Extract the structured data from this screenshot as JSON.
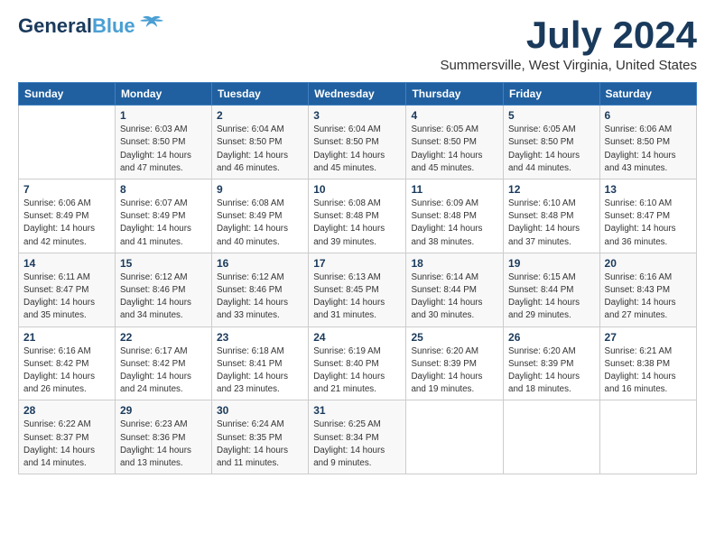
{
  "header": {
    "logo_general": "General",
    "logo_blue": "Blue",
    "month": "July 2024",
    "location": "Summersville, West Virginia, United States"
  },
  "weekdays": [
    "Sunday",
    "Monday",
    "Tuesday",
    "Wednesday",
    "Thursday",
    "Friday",
    "Saturday"
  ],
  "weeks": [
    [
      {
        "day": "",
        "sunrise": "",
        "sunset": "",
        "daylight": ""
      },
      {
        "day": "1",
        "sunrise": "Sunrise: 6:03 AM",
        "sunset": "Sunset: 8:50 PM",
        "daylight": "Daylight: 14 hours and 47 minutes."
      },
      {
        "day": "2",
        "sunrise": "Sunrise: 6:04 AM",
        "sunset": "Sunset: 8:50 PM",
        "daylight": "Daylight: 14 hours and 46 minutes."
      },
      {
        "day": "3",
        "sunrise": "Sunrise: 6:04 AM",
        "sunset": "Sunset: 8:50 PM",
        "daylight": "Daylight: 14 hours and 45 minutes."
      },
      {
        "day": "4",
        "sunrise": "Sunrise: 6:05 AM",
        "sunset": "Sunset: 8:50 PM",
        "daylight": "Daylight: 14 hours and 45 minutes."
      },
      {
        "day": "5",
        "sunrise": "Sunrise: 6:05 AM",
        "sunset": "Sunset: 8:50 PM",
        "daylight": "Daylight: 14 hours and 44 minutes."
      },
      {
        "day": "6",
        "sunrise": "Sunrise: 6:06 AM",
        "sunset": "Sunset: 8:50 PM",
        "daylight": "Daylight: 14 hours and 43 minutes."
      }
    ],
    [
      {
        "day": "7",
        "sunrise": "Sunrise: 6:06 AM",
        "sunset": "Sunset: 8:49 PM",
        "daylight": "Daylight: 14 hours and 42 minutes."
      },
      {
        "day": "8",
        "sunrise": "Sunrise: 6:07 AM",
        "sunset": "Sunset: 8:49 PM",
        "daylight": "Daylight: 14 hours and 41 minutes."
      },
      {
        "day": "9",
        "sunrise": "Sunrise: 6:08 AM",
        "sunset": "Sunset: 8:49 PM",
        "daylight": "Daylight: 14 hours and 40 minutes."
      },
      {
        "day": "10",
        "sunrise": "Sunrise: 6:08 AM",
        "sunset": "Sunset: 8:48 PM",
        "daylight": "Daylight: 14 hours and 39 minutes."
      },
      {
        "day": "11",
        "sunrise": "Sunrise: 6:09 AM",
        "sunset": "Sunset: 8:48 PM",
        "daylight": "Daylight: 14 hours and 38 minutes."
      },
      {
        "day": "12",
        "sunrise": "Sunrise: 6:10 AM",
        "sunset": "Sunset: 8:48 PM",
        "daylight": "Daylight: 14 hours and 37 minutes."
      },
      {
        "day": "13",
        "sunrise": "Sunrise: 6:10 AM",
        "sunset": "Sunset: 8:47 PM",
        "daylight": "Daylight: 14 hours and 36 minutes."
      }
    ],
    [
      {
        "day": "14",
        "sunrise": "Sunrise: 6:11 AM",
        "sunset": "Sunset: 8:47 PM",
        "daylight": "Daylight: 14 hours and 35 minutes."
      },
      {
        "day": "15",
        "sunrise": "Sunrise: 6:12 AM",
        "sunset": "Sunset: 8:46 PM",
        "daylight": "Daylight: 14 hours and 34 minutes."
      },
      {
        "day": "16",
        "sunrise": "Sunrise: 6:12 AM",
        "sunset": "Sunset: 8:46 PM",
        "daylight": "Daylight: 14 hours and 33 minutes."
      },
      {
        "day": "17",
        "sunrise": "Sunrise: 6:13 AM",
        "sunset": "Sunset: 8:45 PM",
        "daylight": "Daylight: 14 hours and 31 minutes."
      },
      {
        "day": "18",
        "sunrise": "Sunrise: 6:14 AM",
        "sunset": "Sunset: 8:44 PM",
        "daylight": "Daylight: 14 hours and 30 minutes."
      },
      {
        "day": "19",
        "sunrise": "Sunrise: 6:15 AM",
        "sunset": "Sunset: 8:44 PM",
        "daylight": "Daylight: 14 hours and 29 minutes."
      },
      {
        "day": "20",
        "sunrise": "Sunrise: 6:16 AM",
        "sunset": "Sunset: 8:43 PM",
        "daylight": "Daylight: 14 hours and 27 minutes."
      }
    ],
    [
      {
        "day": "21",
        "sunrise": "Sunrise: 6:16 AM",
        "sunset": "Sunset: 8:42 PM",
        "daylight": "Daylight: 14 hours and 26 minutes."
      },
      {
        "day": "22",
        "sunrise": "Sunrise: 6:17 AM",
        "sunset": "Sunset: 8:42 PM",
        "daylight": "Daylight: 14 hours and 24 minutes."
      },
      {
        "day": "23",
        "sunrise": "Sunrise: 6:18 AM",
        "sunset": "Sunset: 8:41 PM",
        "daylight": "Daylight: 14 hours and 23 minutes."
      },
      {
        "day": "24",
        "sunrise": "Sunrise: 6:19 AM",
        "sunset": "Sunset: 8:40 PM",
        "daylight": "Daylight: 14 hours and 21 minutes."
      },
      {
        "day": "25",
        "sunrise": "Sunrise: 6:20 AM",
        "sunset": "Sunset: 8:39 PM",
        "daylight": "Daylight: 14 hours and 19 minutes."
      },
      {
        "day": "26",
        "sunrise": "Sunrise: 6:20 AM",
        "sunset": "Sunset: 8:39 PM",
        "daylight": "Daylight: 14 hours and 18 minutes."
      },
      {
        "day": "27",
        "sunrise": "Sunrise: 6:21 AM",
        "sunset": "Sunset: 8:38 PM",
        "daylight": "Daylight: 14 hours and 16 minutes."
      }
    ],
    [
      {
        "day": "28",
        "sunrise": "Sunrise: 6:22 AM",
        "sunset": "Sunset: 8:37 PM",
        "daylight": "Daylight: 14 hours and 14 minutes."
      },
      {
        "day": "29",
        "sunrise": "Sunrise: 6:23 AM",
        "sunset": "Sunset: 8:36 PM",
        "daylight": "Daylight: 14 hours and 13 minutes."
      },
      {
        "day": "30",
        "sunrise": "Sunrise: 6:24 AM",
        "sunset": "Sunset: 8:35 PM",
        "daylight": "Daylight: 14 hours and 11 minutes."
      },
      {
        "day": "31",
        "sunrise": "Sunrise: 6:25 AM",
        "sunset": "Sunset: 8:34 PM",
        "daylight": "Daylight: 14 hours and 9 minutes."
      },
      {
        "day": "",
        "sunrise": "",
        "sunset": "",
        "daylight": ""
      },
      {
        "day": "",
        "sunrise": "",
        "sunset": "",
        "daylight": ""
      },
      {
        "day": "",
        "sunrise": "",
        "sunset": "",
        "daylight": ""
      }
    ]
  ]
}
